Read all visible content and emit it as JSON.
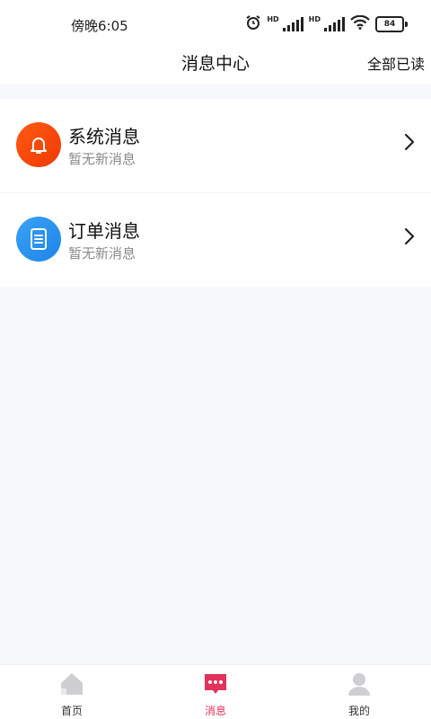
{
  "status_bar": {
    "time": "傍晚6:05",
    "network_label_1": "HD",
    "network_label_2": "HD",
    "battery": "84"
  },
  "header": {
    "title": "消息中心",
    "action": "全部已读"
  },
  "messages": [
    {
      "title": "系统消息",
      "subtitle": "暂无新消息",
      "icon": "bell-icon",
      "color": "#ff5a12"
    },
    {
      "title": "订单消息",
      "subtitle": "暂无新消息",
      "icon": "document-icon",
      "color": "#2b93ef"
    }
  ],
  "tabbar": {
    "items": [
      {
        "label": "首页",
        "icon": "home-icon"
      },
      {
        "label": "消息",
        "icon": "message-icon",
        "active": true,
        "color": "#e2335b"
      },
      {
        "label": "我的",
        "icon": "user-icon"
      }
    ]
  }
}
